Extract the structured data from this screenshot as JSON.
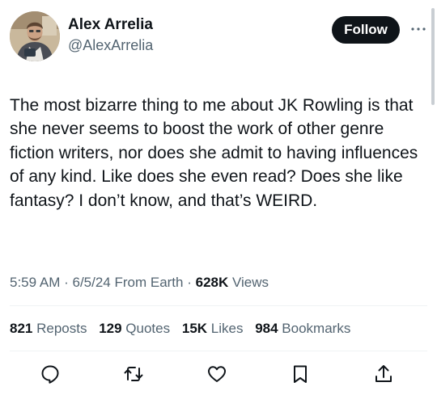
{
  "author": {
    "display_name": "Alex Arrelia",
    "handle": "@AlexArrelia",
    "avatar_icon": "user-avatar-photo"
  },
  "follow_button": {
    "label": "Follow"
  },
  "more_icon": "more-horizontal-icon",
  "tweet": {
    "text": "The most bizarre thing to me about JK Rowling is that she never seems to boost the work of other genre fiction writers, nor does she admit to having influences of any kind. Like does she even read? Does she like fantasy? I don’t know, and that’s WEIRD."
  },
  "meta": {
    "time": "5:59 AM",
    "sep1": " · ",
    "date": "6/5/24",
    "source": " From Earth",
    "sep2": " · ",
    "views_count": "628K",
    "views_label": " Views"
  },
  "stats": [
    {
      "count": "821",
      "label": " Reposts"
    },
    {
      "count": "129",
      "label": " Quotes"
    },
    {
      "count": "15K",
      "label": " Likes"
    },
    {
      "count": "984",
      "label": " Bookmarks"
    }
  ],
  "actions": [
    {
      "name": "reply-button",
      "icon": "reply-icon"
    },
    {
      "name": "repost-button",
      "icon": "repost-icon"
    },
    {
      "name": "like-button",
      "icon": "heart-icon"
    },
    {
      "name": "bookmark-button",
      "icon": "bookmark-icon"
    },
    {
      "name": "share-button",
      "icon": "share-icon"
    }
  ],
  "colors": {
    "primary_text": "#0f1419",
    "secondary_text": "#536471",
    "follow_bg": "#0f1419",
    "follow_text": "#ffffff",
    "divider": "#eff3f4"
  }
}
